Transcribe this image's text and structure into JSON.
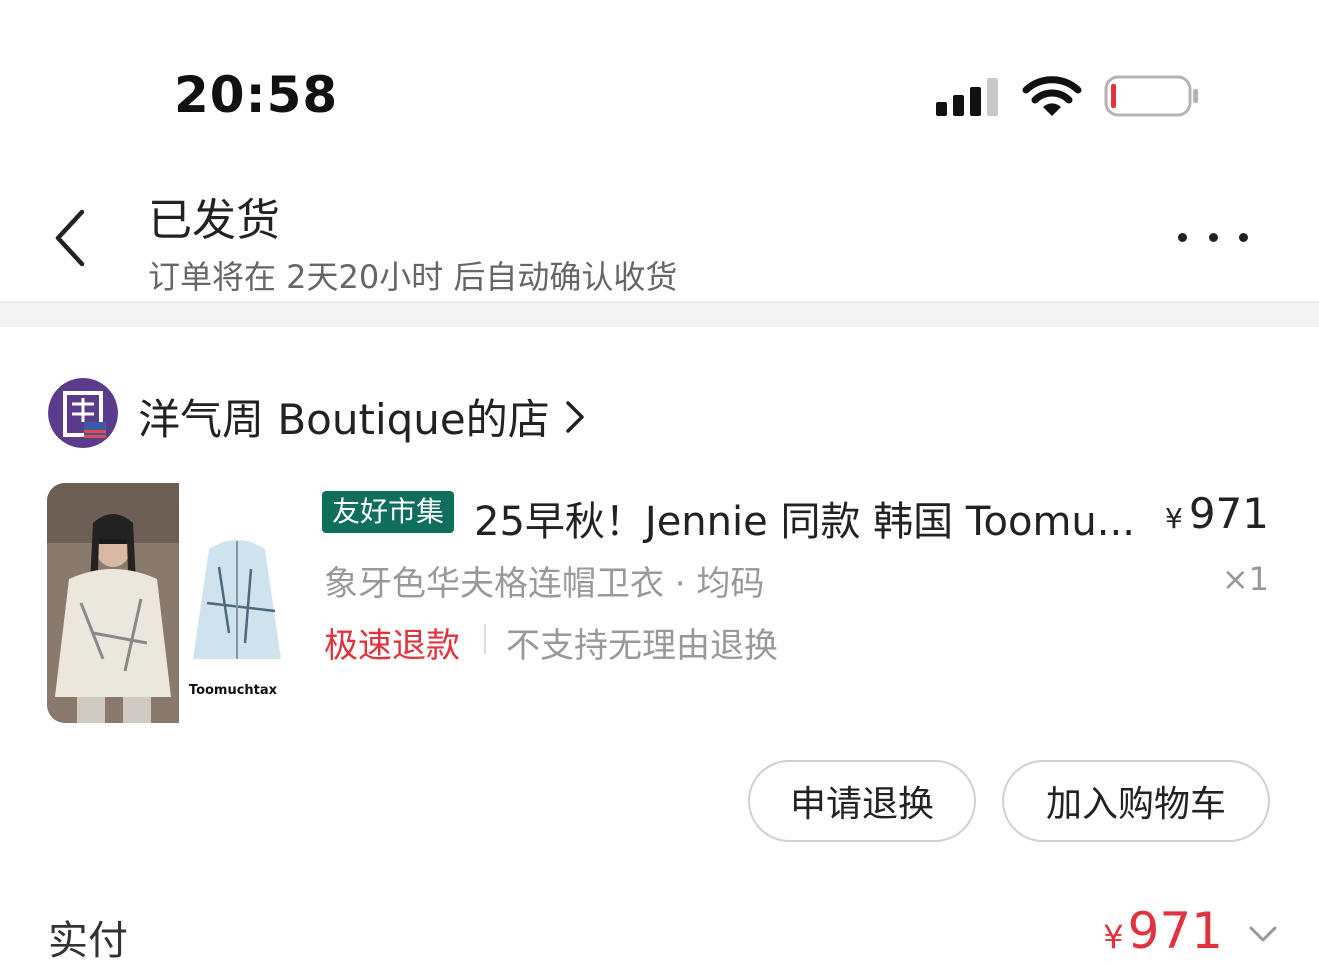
{
  "status_bar": {
    "time": "20:58",
    "signal_icon": "cellular-signal-icon",
    "wifi_icon": "wifi-icon",
    "battery_icon": "battery-low-icon"
  },
  "header": {
    "title": "已发货",
    "subtitle": "订单将在 2天20小时 后自动确认收货",
    "back_icon": "chevron-left-icon",
    "more_icon": "more-dots-icon"
  },
  "shop": {
    "name": "洋气周 Boutique的店",
    "avatar_icon": "shop-avatar",
    "chevron_icon": "chevron-right-icon"
  },
  "product": {
    "badge": "友好市集",
    "title": "25早秋！Jennie 同款 韩国 Toomu...",
    "price_symbol": "¥",
    "price": "971",
    "variant": "象牙色华夫格连帽卫衣 · 均码",
    "quantity": "×1",
    "tag_fast_refund": "极速退款",
    "tag_policy": "不支持无理由退换",
    "image_caption": "Toomuchtax"
  },
  "actions": {
    "refund_label": "申请退换",
    "cart_label": "加入购物车"
  },
  "payment": {
    "label": "实付",
    "symbol": "¥",
    "amount": "971",
    "expand_icon": "chevron-down-icon"
  },
  "colors": {
    "accent_red": "#e0333e",
    "badge_green": "#0f6e5c",
    "muted_text": "#999999"
  }
}
